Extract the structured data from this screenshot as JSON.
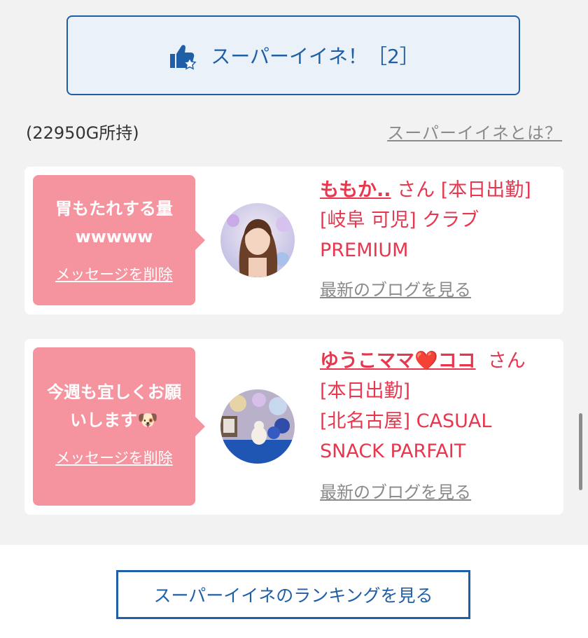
{
  "super_like": {
    "label": "スーパーイイネ！［2］",
    "icon": "thumbs-up-star-icon"
  },
  "balance": "(22950G所持)",
  "about_link": "スーパーイイネとは？",
  "cards": [
    {
      "message": "胃もたれする量\nwwwww",
      "delete_label": "メッセージを削除",
      "name": "ももか..",
      "san": "さん",
      "status": "[本日出勤]",
      "area": "[岐阜 可児] クラブ",
      "club": "PREMIUM",
      "blog_label": "最新のブログを見る"
    },
    {
      "message": "今週も宜しくお願\nいします🐶",
      "delete_label": "メッセージを削除",
      "name": "ゆうこママ❤️ココ",
      "san": "さん",
      "status": "[本日出勤]",
      "area": "[北名古屋] CASUAL",
      "club": "SNACK PARFAIT",
      "blog_label": "最新のブログを見る"
    }
  ],
  "ranking_button": "スーパーイイネのランキングを見る",
  "colors": {
    "accent_blue": "#1f5fa8",
    "pink": "#f5949f",
    "name_red": "#e8364e"
  }
}
